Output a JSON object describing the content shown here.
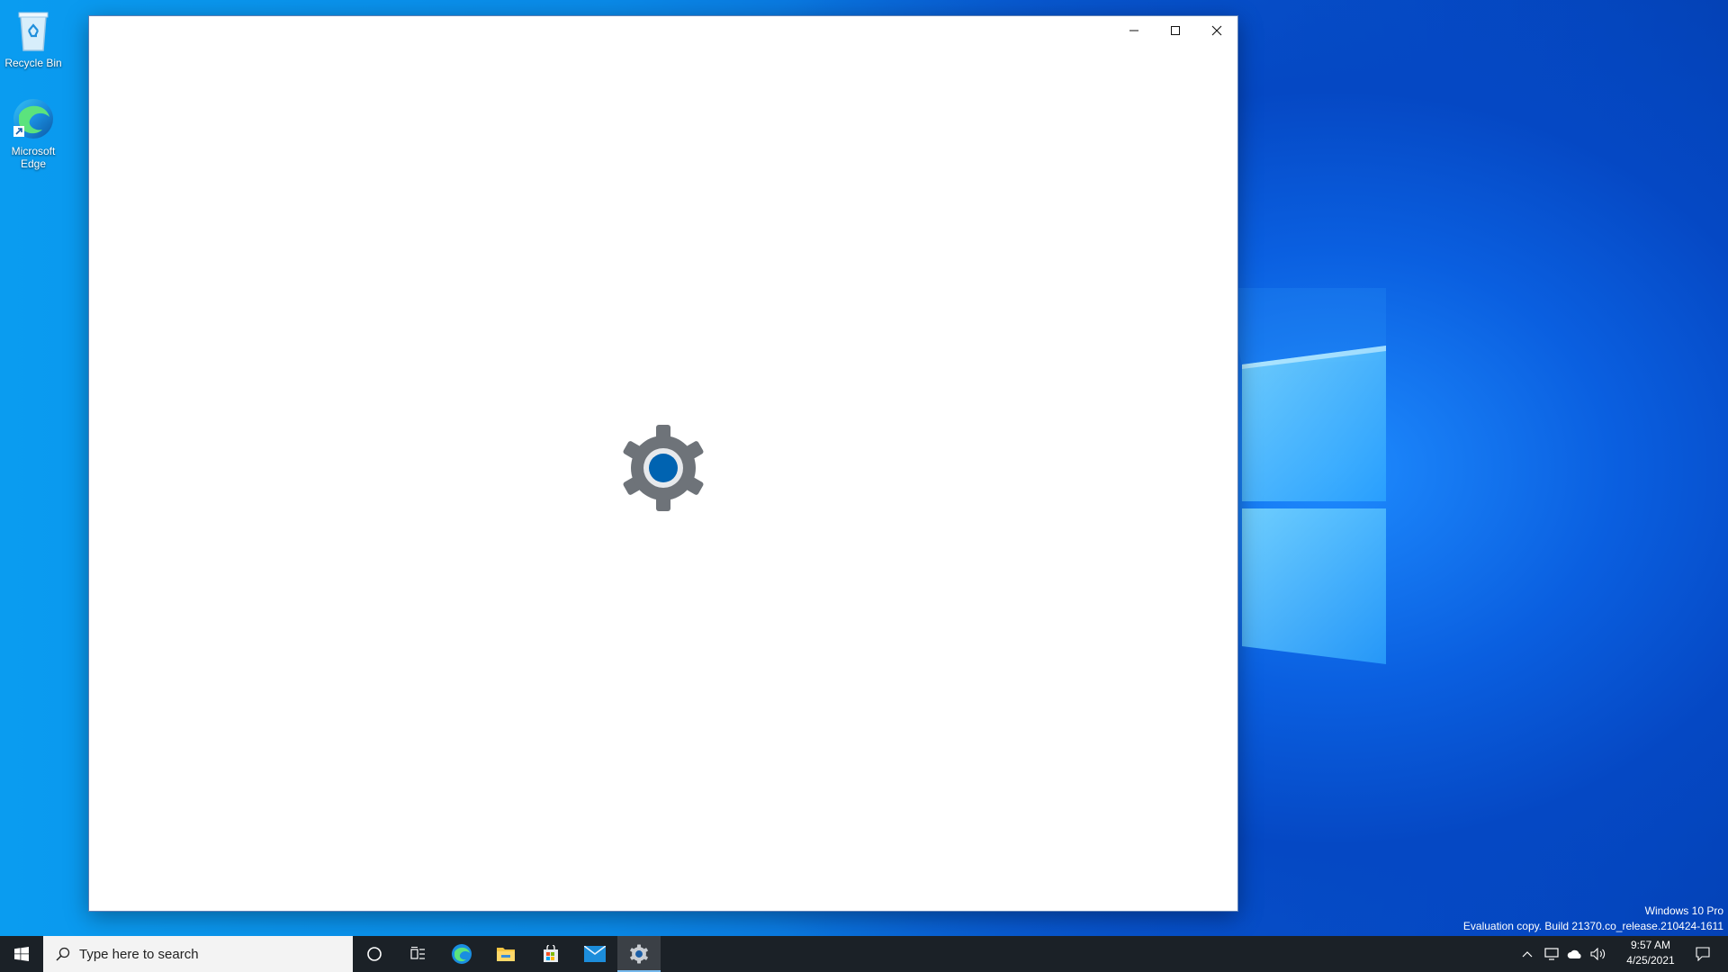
{
  "desktop": {
    "icons": [
      {
        "label": "Recycle Bin",
        "icon": "recycle-bin-icon"
      },
      {
        "label": "Microsoft Edge",
        "icon": "edge-icon"
      }
    ],
    "watermark": {
      "line1": "Windows 10 Pro",
      "line2": "Evaluation copy. Build 21370.co_release.210424-1611"
    }
  },
  "window": {
    "title": "",
    "splash_icon": "settings-gear-icon",
    "controls": {
      "minimize": "minimize-icon",
      "maximize": "maximize-icon",
      "close": "close-icon"
    }
  },
  "taskbar": {
    "search_placeholder": "Type here to search",
    "pinned": [
      "start-icon",
      "cortana-icon",
      "task-view-icon",
      "edge-icon",
      "file-explorer-icon",
      "store-icon",
      "mail-icon",
      "settings-icon"
    ],
    "active_app": "settings-icon",
    "clock": {
      "time": "9:57 AM",
      "date": "4/25/2021"
    },
    "tray": [
      "chevron-up-icon",
      "network-icon",
      "onedrive-icon",
      "volume-icon",
      "notification-icon"
    ]
  },
  "colors": {
    "accent": "#0063b1",
    "gear": "#6e7379",
    "taskbar": "#1b2127"
  }
}
